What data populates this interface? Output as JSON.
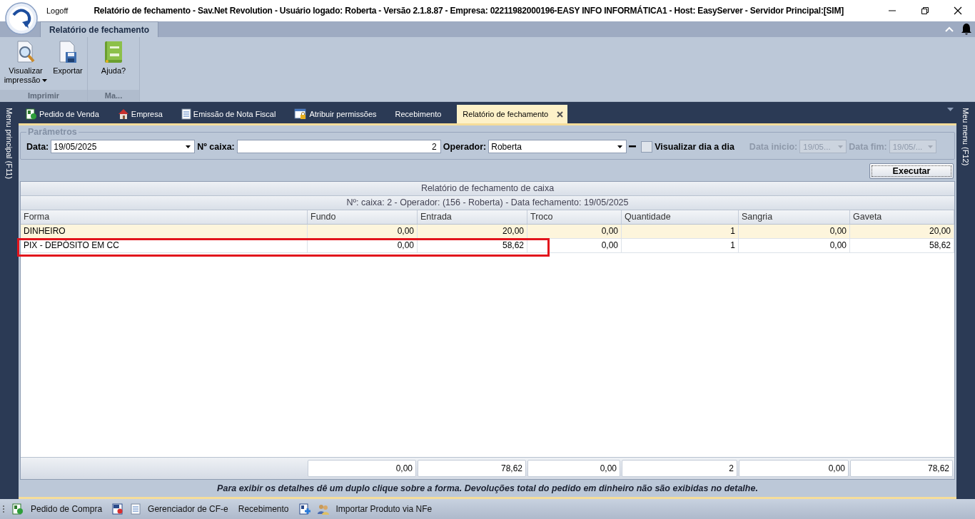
{
  "window": {
    "logoff": "Logoff",
    "title": "Relatório de fechamento - Sav.Net Revolution - Usuário logado: Roberta - Versão 2.1.8.87 - Empresa: 02211982000196-EASY INFO INFORMÁTICA1 - Host: EasyServer - Servidor Principal:[SIM]"
  },
  "ribbon": {
    "tabs": [
      {
        "label": "Relatório de fechamento",
        "selected": true
      }
    ],
    "groups": [
      {
        "label": "Imprimir",
        "buttons": [
          {
            "label": "Visualizar impressão",
            "dropdown": true
          },
          {
            "label": "Exportar",
            "dropdown": false
          }
        ]
      },
      {
        "label": "Ma...",
        "buttons": [
          {
            "label": "Ajuda?",
            "dropdown": false
          }
        ]
      }
    ]
  },
  "side_left": "Menu principal (F11)",
  "side_right": "Meu menu (F12)",
  "doc_tabs": [
    {
      "label": "Pedido de Venda",
      "selected": false
    },
    {
      "label": "Empresa",
      "selected": false
    },
    {
      "label": "Emissão de Nota Fiscal",
      "selected": false
    },
    {
      "label": "Atribuir permissões",
      "selected": false
    },
    {
      "label": "Recebimento",
      "selected": false
    },
    {
      "label": "Relatório de fechamento",
      "selected": true
    }
  ],
  "params": {
    "title": "Parâmetros",
    "data_label": "Data:",
    "data_value": "19/05/2025",
    "caixa_label": "Nº caixa:",
    "caixa_value": "2",
    "operador_label": "Operador:",
    "operador_value": "Roberta",
    "dia_a_dia": {
      "label": "Visualizar dia a dia",
      "checked": false
    },
    "inicio": {
      "label": "Data inicio:",
      "value": "19/05...",
      "disabled": true
    },
    "fim": {
      "label": "Data fim:",
      "value": "19/05/...",
      "disabled": true
    }
  },
  "execute_button": "Executar",
  "grid": {
    "title": "Relatório de fechamento de caixa",
    "subtitle": "Nº: caixa: 2 - Operador: (156 - Roberta) - Data fechamento: 19/05/2025",
    "columns": [
      "Forma",
      "Fundo",
      "Entrada",
      "Troco",
      "Quantidade",
      "Sangria",
      "Gaveta"
    ],
    "rows": [
      {
        "cells": [
          "DINHEIRO",
          "0,00",
          "20,00",
          "0,00",
          "1",
          "0,00",
          "20,00"
        ],
        "highlighted": false
      },
      {
        "cells": [
          "PIX - DEPÓSITO EM CC",
          "0,00",
          "58,62",
          "0,00",
          "1",
          "0,00",
          "58,62"
        ],
        "highlighted": true
      }
    ],
    "totals": [
      "0,00",
      "78,62",
      "0,00",
      "2",
      "0,00",
      "78,62"
    ]
  },
  "note": "Para exibir os detalhes dê um duplo clique sobre a forma. Devoluções total do pedido em dinheiro não são exibidas no detalhe.",
  "bottom_toolbar": [
    "Pedido de Compra",
    "Gerenciador de CF-e",
    "Recebimento",
    "Importar Produto via NFe"
  ]
}
